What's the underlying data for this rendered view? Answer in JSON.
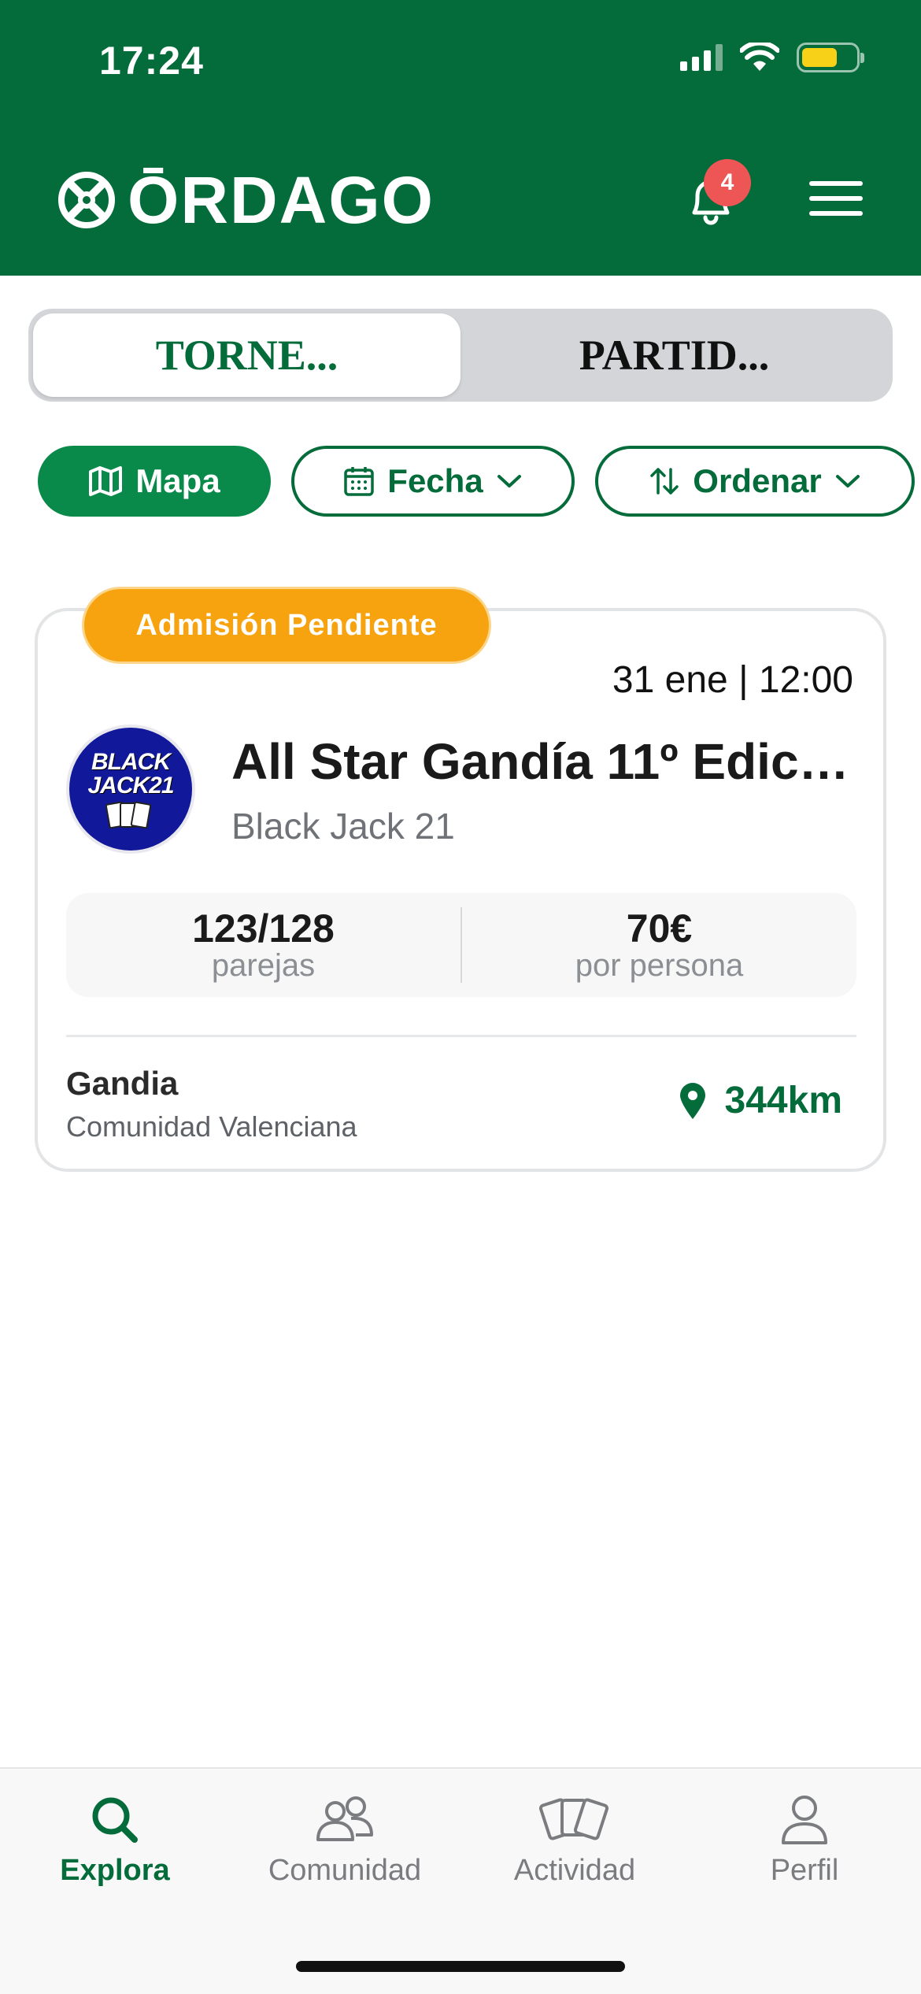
{
  "status_bar": {
    "time": "17:24"
  },
  "header": {
    "brand": "ŌRDAGO",
    "notifications_count": "4",
    "colors": {
      "primary": "#046b3a",
      "badge": "#ee5656"
    }
  },
  "segmented": {
    "tabs": [
      {
        "label": "TORNE...",
        "active": true
      },
      {
        "label": "PARTID...",
        "active": false
      }
    ]
  },
  "filters": {
    "map": "Mapa",
    "date": "Fecha",
    "sort": "Ordenar"
  },
  "tournament_card": {
    "status": "Admisión Pendiente",
    "datetime": "31 ene | 12:00",
    "title": "All Star Gandía 11º Edici...",
    "club": "Black Jack 21",
    "club_logo_text": [
      "BLACK",
      "JACK21"
    ],
    "pairs_value": "123/128",
    "pairs_label": "parejas",
    "price_value": "70€",
    "price_label": "por persona",
    "city": "Gandia",
    "region": "Comunidad Valenciana",
    "distance": "344km",
    "colors": {
      "status_pill": "#f7a30f"
    }
  },
  "tabbar": {
    "items": [
      {
        "label": "Explora",
        "icon": "search-icon",
        "active": true
      },
      {
        "label": "Comunidad",
        "icon": "users-icon",
        "active": false
      },
      {
        "label": "Actividad",
        "icon": "cards-icon",
        "active": false
      },
      {
        "label": "Perfil",
        "icon": "person-icon",
        "active": false
      }
    ]
  }
}
